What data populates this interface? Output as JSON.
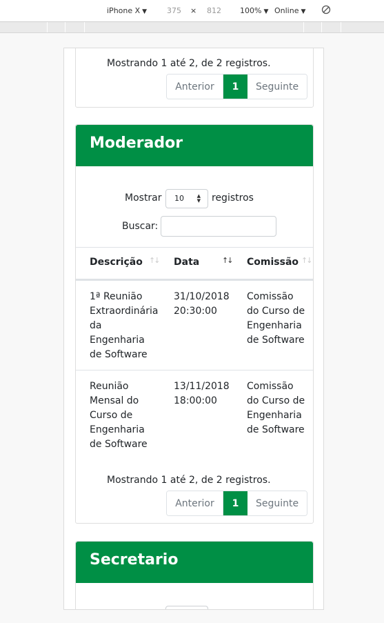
{
  "devtools": {
    "device": "iPhone X",
    "width": "375",
    "times": "×",
    "height": "812",
    "zoom": "100%",
    "network": "Online"
  },
  "top_card": {
    "info": "Mostrando 1 até 2, de 2 registros.",
    "pagination": {
      "prev": "Anterior",
      "current": "1",
      "next": "Seguinte"
    }
  },
  "moderador": {
    "title": "Moderador",
    "length_label_before": "Mostrar",
    "length_value": "10",
    "length_label_after": "registros",
    "search_label": "Buscar:",
    "search_value": "",
    "columns": [
      "Descrição",
      "Data",
      "Comissão"
    ],
    "rows": [
      {
        "descricao": [
          "1ª Reunião",
          "Extraordinária",
          "da",
          "Engenharia",
          "de Software"
        ],
        "data": [
          "31/10/2018",
          "20:30:00"
        ],
        "comissao": [
          "Comissão",
          "do Curso de",
          "Engenharia",
          "de Software"
        ]
      },
      {
        "descricao": [
          "Reunião",
          "Mensal do",
          "Curso de",
          "Engenharia",
          "de Software"
        ],
        "data": [
          "13/11/2018",
          "18:00:00"
        ],
        "comissao": [
          "Comissão",
          "do Curso de",
          "Engenharia",
          "de Software"
        ]
      }
    ],
    "info": "Mostrando 1 até 2, de 2 registros.",
    "pagination": {
      "prev": "Anterior",
      "current": "1",
      "next": "Seguinte"
    }
  },
  "secretario": {
    "title": "Secretario"
  },
  "colors": {
    "brand_green": "#008f45",
    "border": "#dee2e6",
    "muted": "#6c757d"
  }
}
